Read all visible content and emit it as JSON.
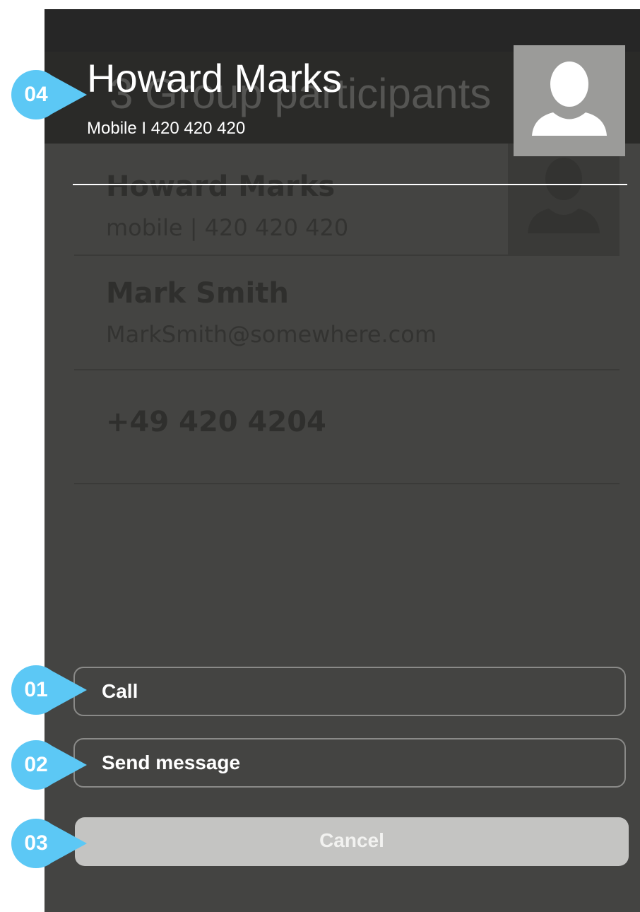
{
  "background_list": {
    "header_title": "3 Group participants",
    "rows": [
      {
        "name": "Howard Marks",
        "sub": "mobile  |  420 420 420"
      },
      {
        "name": "Mark Smith",
        "sub": "MarkSmith@somewhere.com"
      },
      {
        "name": "+49 420 4204",
        "sub": ""
      }
    ]
  },
  "contact": {
    "name": "Howard Marks",
    "detail": "Mobile  I  420 420 420",
    "avatar_icon": "person-silhouette-icon"
  },
  "actions": {
    "call_label": "Call",
    "message_label": "Send message",
    "cancel_label": "Cancel"
  },
  "annotations": {
    "a1": "01",
    "a2": "02",
    "a3": "03",
    "a4": "04"
  },
  "colors": {
    "callout": "#5cc8f5",
    "screen_bg": "#444442",
    "header_bg": "#262626",
    "cancel_bg": "#c4c4c2"
  }
}
